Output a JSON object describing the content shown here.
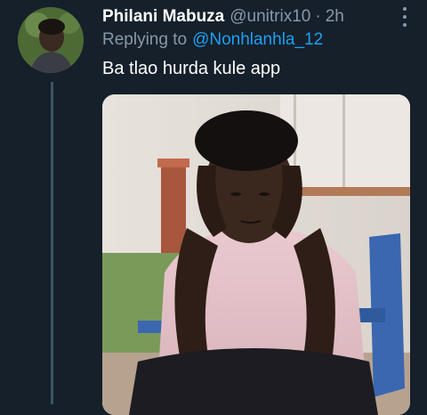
{
  "tweet": {
    "display_name": "Philani Mabuza",
    "handle": "@unitrix10",
    "separator": "·",
    "time": "2h",
    "reply_prefix": "Replying to",
    "reply_to": "@Nonhlanhla_12",
    "text": "Ba tlao hurda kule app",
    "avatar_icon": "user-avatar",
    "media_icon": "photo-image"
  },
  "colors": {
    "background": "#15202b",
    "text_primary": "#ffffff",
    "text_secondary": "#8899a6",
    "link": "#1da1f2",
    "thread_line": "#3d5466"
  }
}
